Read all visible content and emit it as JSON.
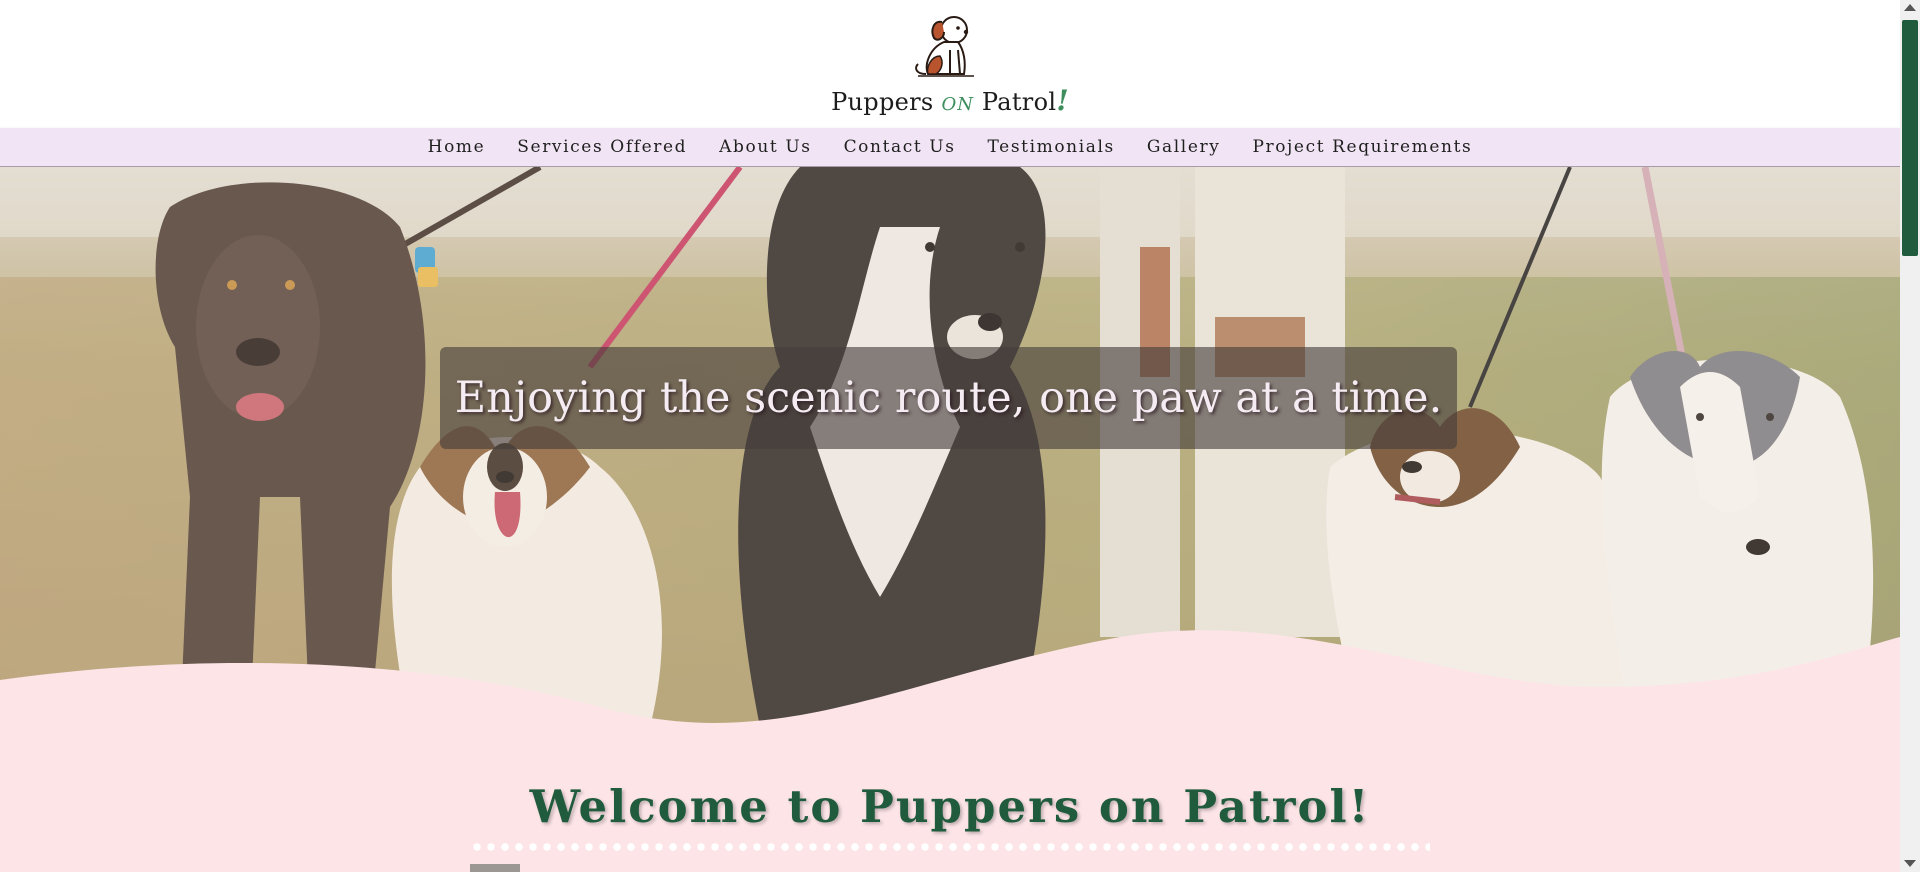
{
  "brand": {
    "name_part1": "Puppers ",
    "name_on": "ON",
    "name_part2": " Patrol",
    "name_bang": "!",
    "logo_icon": "sitting-dog-icon"
  },
  "nav": {
    "items": [
      {
        "label": "Home"
      },
      {
        "label": "Services Offered"
      },
      {
        "label": "About Us"
      },
      {
        "label": "Contact Us"
      },
      {
        "label": "Testimonials"
      },
      {
        "label": "Gallery"
      },
      {
        "label": "Project Requirements"
      }
    ]
  },
  "hero": {
    "tagline": "Enjoying the scenic route, one paw at a time."
  },
  "welcome": {
    "heading": "Welcome to Puppers on Patrol!"
  },
  "colors": {
    "accent_green": "#1f5b3c",
    "nav_bg": "#f1e4f4",
    "page_bg": "#fce4e7",
    "brand_green": "#3e8e5d"
  }
}
